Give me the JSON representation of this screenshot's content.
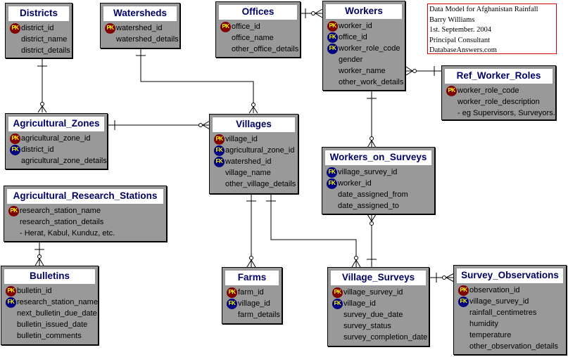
{
  "note": {
    "lines": [
      "Data Model for Afghanistan Rainfall",
      "Barry Williams",
      "1st. September. 2004",
      "Principal Consultant",
      "DatabaseAnswers.com"
    ]
  },
  "key_labels": {
    "pk": "PK",
    "fk": "FK"
  },
  "colors": {
    "entity_fill": "#999999",
    "title_text": "#000066",
    "pk_badge": "#800000",
    "fk_badge": "#000080",
    "badge_text": "#ffff00",
    "note_border": "#d00000"
  },
  "entities": {
    "districts": {
      "title": "Districts",
      "attrs": [
        {
          "key": "pk",
          "name": "district_id"
        },
        {
          "key": "",
          "name": "district_name"
        },
        {
          "key": "",
          "name": "district_details"
        }
      ]
    },
    "watersheds": {
      "title": "Watersheds",
      "attrs": [
        {
          "key": "pk",
          "name": "watershed_id"
        },
        {
          "key": "",
          "name": "watershed_details"
        }
      ]
    },
    "offices": {
      "title": "Offices",
      "attrs": [
        {
          "key": "pk",
          "name": "office_id"
        },
        {
          "key": "",
          "name": "office_name"
        },
        {
          "key": "",
          "name": "other_office_details"
        }
      ]
    },
    "workers": {
      "title": "Workers",
      "attrs": [
        {
          "key": "pk",
          "name": "worker_id"
        },
        {
          "key": "fk",
          "name": "office_id"
        },
        {
          "key": "fk",
          "name": "worker_role_code"
        },
        {
          "key": "",
          "name": "gender"
        },
        {
          "key": "",
          "name": "worker_name"
        },
        {
          "key": "",
          "name": "other_work_details"
        }
      ]
    },
    "ref_worker_roles": {
      "title": "Ref_Worker_Roles",
      "attrs": [
        {
          "key": "pk",
          "name": "worker_role_code"
        },
        {
          "key": "",
          "name": "worker_role_description"
        },
        {
          "key": "",
          "name": "- eg Supervisors, Surveyors."
        }
      ]
    },
    "agricultural_zones": {
      "title": "Agricultural_Zones",
      "attrs": [
        {
          "key": "pk",
          "name": "agricultural_zone_id"
        },
        {
          "key": "fk",
          "name": "district_id"
        },
        {
          "key": "",
          "name": "agricultural_zone_details"
        }
      ]
    },
    "villages": {
      "title": "Villages",
      "attrs": [
        {
          "key": "pk",
          "name": "village_id"
        },
        {
          "key": "fk",
          "name": "agricultural_zone_id"
        },
        {
          "key": "fk",
          "name": "watershed_id"
        },
        {
          "key": "",
          "name": "village_name"
        },
        {
          "key": "",
          "name": "other_village_details"
        }
      ]
    },
    "workers_on_surveys": {
      "title": "Workers_on_Surveys",
      "attrs": [
        {
          "key": "fk",
          "name": "village_survey_id"
        },
        {
          "key": "fk",
          "name": "worker_id"
        },
        {
          "key": "",
          "name": "date_assigned_from"
        },
        {
          "key": "",
          "name": "date_assigned_to"
        }
      ]
    },
    "agricultural_research_stations": {
      "title": "Agricultural_Research_Stations",
      "attrs": [
        {
          "key": "pk",
          "name": "research_station_name"
        },
        {
          "key": "",
          "name": "research_station_details"
        },
        {
          "key": "",
          "name": "- Herat, Kabul, Kunduz, etc."
        }
      ]
    },
    "bulletins": {
      "title": "Bulletins",
      "attrs": [
        {
          "key": "pk",
          "name": "bulletin_id"
        },
        {
          "key": "fk",
          "name": "research_station_name"
        },
        {
          "key": "",
          "name": "next_bulletin_due_date"
        },
        {
          "key": "",
          "name": "bulletin_issued_date"
        },
        {
          "key": "",
          "name": "bulletin_comments"
        }
      ]
    },
    "farms": {
      "title": "Farms",
      "attrs": [
        {
          "key": "pk",
          "name": "farm_id"
        },
        {
          "key": "fk",
          "name": "village_id"
        },
        {
          "key": "",
          "name": "farm_details"
        }
      ]
    },
    "village_surveys": {
      "title": "Village_Surveys",
      "attrs": [
        {
          "key": "pk",
          "name": "village_survey_id"
        },
        {
          "key": "fk",
          "name": "village_id"
        },
        {
          "key": "",
          "name": "survey_due_date"
        },
        {
          "key": "",
          "name": "survey_status"
        },
        {
          "key": "",
          "name": "survey_completion_date"
        }
      ]
    },
    "survey_observations": {
      "title": "Survey_Observations",
      "attrs": [
        {
          "key": "pk",
          "name": "observation_id"
        },
        {
          "key": "fk",
          "name": "village_survey_id"
        },
        {
          "key": "",
          "name": "rainfall_centimetres"
        },
        {
          "key": "",
          "name": "humidity"
        },
        {
          "key": "",
          "name": "temperature"
        },
        {
          "key": "",
          "name": "other_observation_details"
        }
      ]
    }
  },
  "relationships": [
    {
      "from": "Districts",
      "to": "Agricultural_Zones",
      "type": "one-to-zero-or-many"
    },
    {
      "from": "Watersheds",
      "to": "Villages",
      "type": "one-to-zero-or-many"
    },
    {
      "from": "Agricultural_Zones",
      "to": "Villages",
      "type": "one-to-zero-or-many"
    },
    {
      "from": "Offices",
      "to": "Workers",
      "type": "one-to-zero-or-many"
    },
    {
      "from": "Ref_Worker_Roles",
      "to": "Workers",
      "type": "one-to-zero-or-many"
    },
    {
      "from": "Workers",
      "to": "Workers_on_Surveys",
      "type": "one-to-zero-or-many"
    },
    {
      "from": "Village_Surveys",
      "to": "Workers_on_Surveys",
      "type": "one-to-zero-or-many"
    },
    {
      "from": "Villages",
      "to": "Farms",
      "type": "one-to-zero-or-many"
    },
    {
      "from": "Villages",
      "to": "Village_Surveys",
      "type": "one-to-zero-or-many"
    },
    {
      "from": "Agricultural_Research_Stations",
      "to": "Bulletins",
      "type": "one-to-zero-or-many"
    },
    {
      "from": "Village_Surveys",
      "to": "Survey_Observations",
      "type": "one-to-zero-or-many"
    }
  ]
}
